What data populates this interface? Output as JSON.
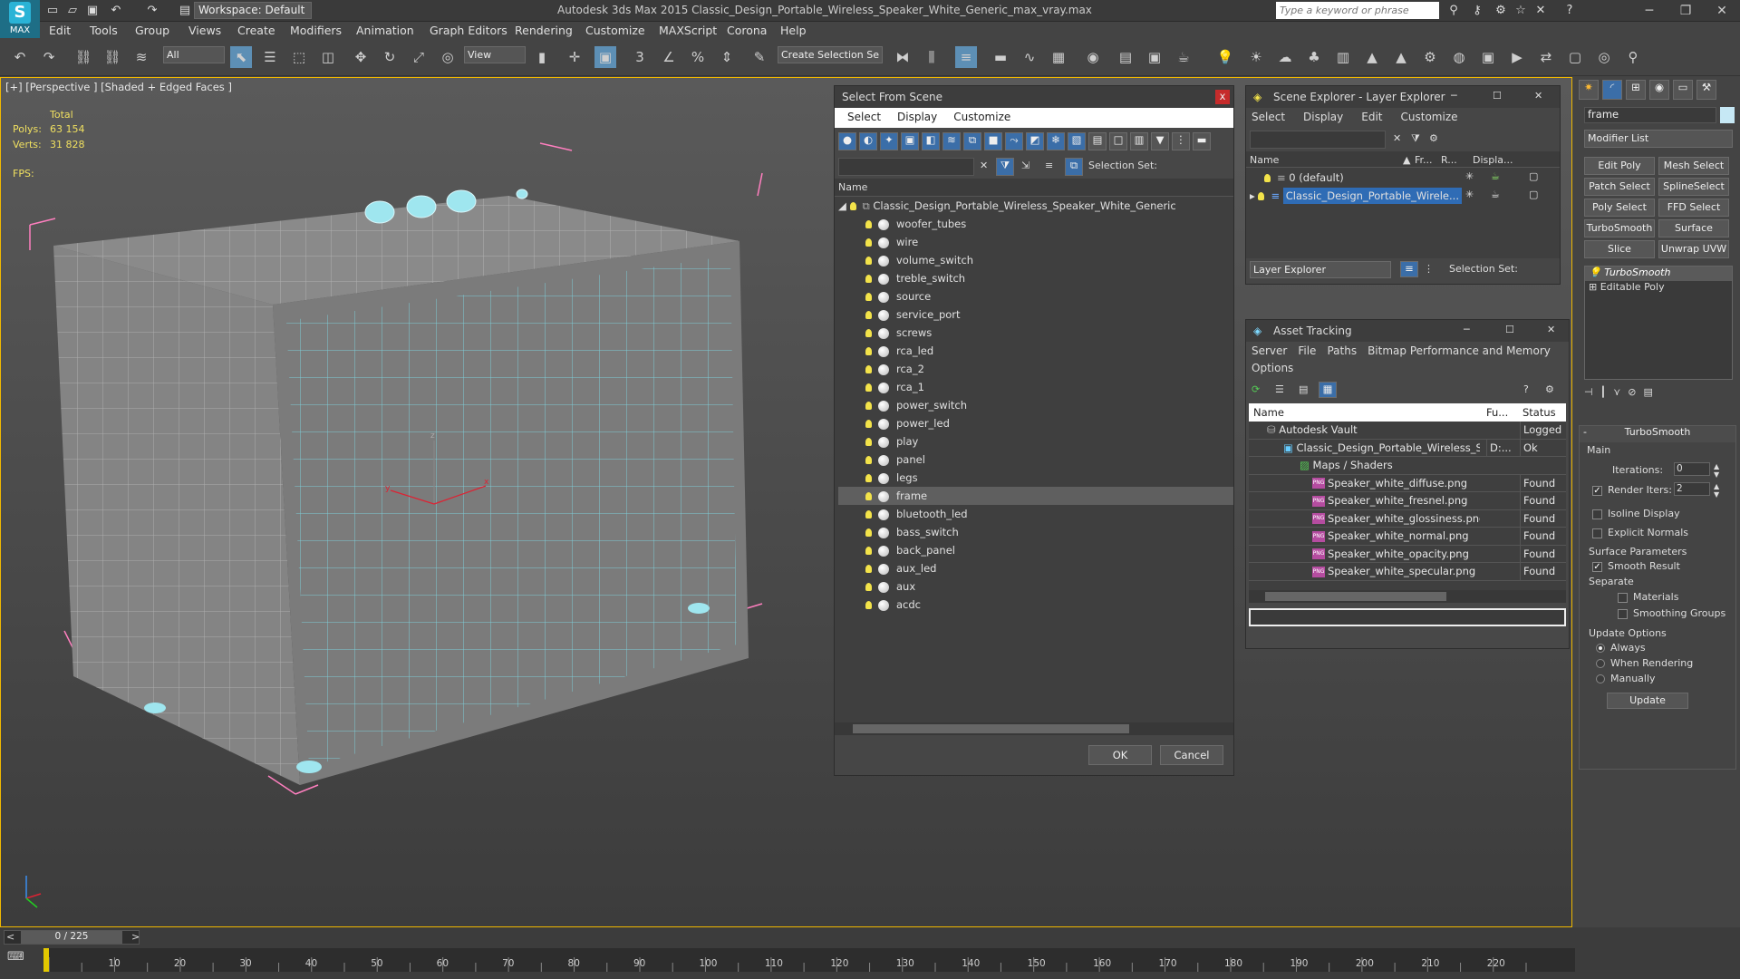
{
  "app": {
    "logo_text": "MAX",
    "workspace": "Workspace: Default",
    "title": "Autodesk 3ds Max  2015      Classic_Design_Portable_Wireless_Speaker_White_Generic_max_vray.max",
    "search_placeholder": "Type a keyword or phrase"
  },
  "menu": [
    "Edit",
    "Tools",
    "Group",
    "Views",
    "Create",
    "Modifiers",
    "Animation",
    "Graph Editors",
    "Rendering",
    "Customize",
    "MAXScript",
    "Corona",
    "Help"
  ],
  "toolbar": {
    "filter_select": "All",
    "refcoord_select": "View",
    "selection_set": "Create Selection Se"
  },
  "viewport": {
    "label": "[+] [Perspective ] [Shaded + Edged Faces ]",
    "stats_header": "Total",
    "polys_label": "Polys:",
    "polys_value": "63 154",
    "verts_label": "Verts:",
    "verts_value": "31 828",
    "fps_label": "FPS:"
  },
  "select_from_scene": {
    "title": "Select From Scene",
    "close": "x",
    "menu": [
      "Select",
      "Display",
      "Customize"
    ],
    "selection_set_label": "Selection Set:",
    "column_name": "Name",
    "root": "Classic_Design_Portable_Wireless_Speaker_White_Generic",
    "objects": [
      "woofer_tubes",
      "wire",
      "volume_switch",
      "treble_switch",
      "source",
      "service_port",
      "screws",
      "rca_led",
      "rca_2",
      "rca_1",
      "power_switch",
      "power_led",
      "play",
      "panel",
      "legs",
      "frame",
      "bluetooth_led",
      "bass_switch",
      "back_panel",
      "aux_led",
      "aux",
      "acdc"
    ],
    "selected": "frame",
    "ok": "OK",
    "cancel": "Cancel"
  },
  "scene_explorer": {
    "title": "Scene Explorer - Layer Explorer",
    "menu": [
      "Select",
      "Display",
      "Edit",
      "Customize"
    ],
    "columns": [
      "Name",
      "Fr...",
      "R...",
      "Displa..."
    ],
    "layers": [
      "0 (default)",
      "Classic_Design_Portable_Wirele..."
    ],
    "footer_select": "Layer Explorer",
    "selection_set_label": "Selection Set:"
  },
  "asset_tracking": {
    "title": "Asset Tracking",
    "menu": [
      "Server",
      "File",
      "Paths",
      "Bitmap Performance and Memory"
    ],
    "menu2": "Options",
    "columns": [
      "Name",
      "Fu...",
      "Status"
    ],
    "rows": [
      {
        "name": "Autodesk Vault",
        "full": "",
        "status": "Logged"
      },
      {
        "name": "Classic_Design_Portable_Wireless_Sp...",
        "full": "D:...",
        "status": "Ok"
      },
      {
        "name": "Maps / Shaders",
        "full": "",
        "status": ""
      },
      {
        "name": "Speaker_white_diffuse.png",
        "full": "",
        "status": "Found"
      },
      {
        "name": "Speaker_white_fresnel.png",
        "full": "",
        "status": "Found"
      },
      {
        "name": "Speaker_white_glossiness.png",
        "full": "",
        "status": "Found"
      },
      {
        "name": "Speaker_white_normal.png",
        "full": "",
        "status": "Found"
      },
      {
        "name": "Speaker_white_opacity.png",
        "full": "",
        "status": "Found"
      },
      {
        "name": "Speaker_white_specular.png",
        "full": "",
        "status": "Found"
      }
    ]
  },
  "command_panel": {
    "object_name": "frame",
    "modifier_list": "Modifier List",
    "buttons": [
      "Edit Poly",
      "Mesh Select",
      "Patch Select",
      "SplineSelect",
      "Poly Select",
      "FFD Select",
      "TurboSmooth",
      "Surface Select",
      "Slice",
      "Unwrap UVW"
    ],
    "stack": [
      "TurboSmooth",
      "Editable Poly"
    ],
    "rollout_title": "TurboSmooth",
    "main_label": "Main",
    "iterations_label": "Iterations:",
    "iterations_value": "0",
    "render_iters_label": "Render Iters:",
    "render_iters_value": "2",
    "isoline": "Isoline Display",
    "explicit_normals": "Explicit Normals",
    "surface_params": "Surface Parameters",
    "smooth_result": "Smooth Result",
    "separate": "Separate",
    "materials": "Materials",
    "smoothing_groups": "Smoothing Groups",
    "update_options": "Update Options",
    "always": "Always",
    "when_rendering": "When Rendering",
    "manually": "Manually",
    "update_btn": "Update"
  },
  "timeline": {
    "frame_counter": "0 / 225",
    "ticks": [
      "10",
      "20",
      "30",
      "40",
      "50",
      "60",
      "70",
      "80",
      "90",
      "100",
      "110",
      "120",
      "130",
      "140",
      "150",
      "160",
      "170",
      "180",
      "190",
      "200",
      "210",
      "220"
    ]
  }
}
